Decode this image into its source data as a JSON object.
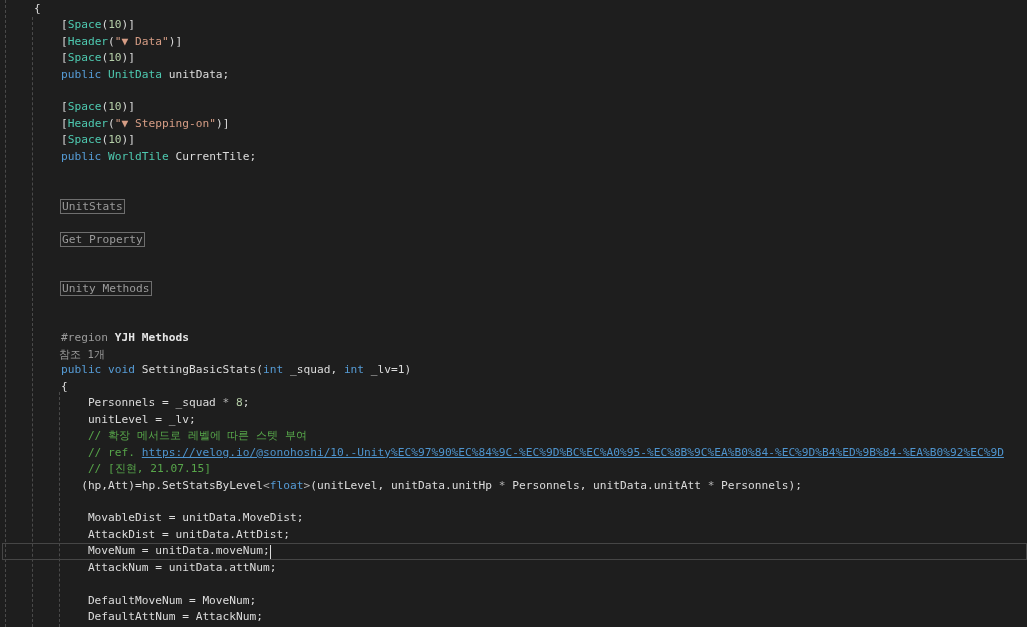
{
  "editor": {
    "lines": [
      {
        "current": false,
        "segments": [
          {
            "text": "{",
            "kind": "plain"
          }
        ]
      },
      {
        "current": false,
        "segments": [
          {
            "text": "    [",
            "kind": "plain"
          },
          {
            "text": "Space",
            "kind": "type"
          },
          {
            "text": "(",
            "kind": "plain"
          },
          {
            "text": "10",
            "kind": "number"
          },
          {
            "text": ")]",
            "kind": "plain"
          }
        ]
      },
      {
        "current": false,
        "segments": [
          {
            "text": "    [",
            "kind": "plain"
          },
          {
            "text": "Header",
            "kind": "type"
          },
          {
            "text": "(",
            "kind": "plain"
          },
          {
            "text": "\"▼ Data\"",
            "kind": "string"
          },
          {
            "text": ")]",
            "kind": "plain"
          }
        ]
      },
      {
        "current": false,
        "segments": [
          {
            "text": "    [",
            "kind": "plain"
          },
          {
            "text": "Space",
            "kind": "type"
          },
          {
            "text": "(",
            "kind": "plain"
          },
          {
            "text": "10",
            "kind": "number"
          },
          {
            "text": ")]",
            "kind": "plain"
          }
        ]
      },
      {
        "current": false,
        "segments": [
          {
            "text": "    public ",
            "kind": "keyword"
          },
          {
            "text": "UnitData",
            "kind": "type"
          },
          {
            "text": " unitData;",
            "kind": "plain"
          }
        ]
      },
      {
        "current": false
      },
      {
        "current": false,
        "segments": [
          {
            "text": "    [",
            "kind": "plain"
          },
          {
            "text": "Space",
            "kind": "type"
          },
          {
            "text": "(",
            "kind": "plain"
          },
          {
            "text": "10",
            "kind": "number"
          },
          {
            "text": ")]",
            "kind": "plain"
          }
        ]
      },
      {
        "current": false,
        "segments": [
          {
            "text": "    [",
            "kind": "plain"
          },
          {
            "text": "Header",
            "kind": "type"
          },
          {
            "text": "(",
            "kind": "plain"
          },
          {
            "text": "\"▼ Stepping-on\"",
            "kind": "string"
          },
          {
            "text": ")]",
            "kind": "plain"
          }
        ]
      },
      {
        "current": false,
        "segments": [
          {
            "text": "    [",
            "kind": "plain"
          },
          {
            "text": "Space",
            "kind": "type"
          },
          {
            "text": "(",
            "kind": "plain"
          },
          {
            "text": "10",
            "kind": "number"
          },
          {
            "text": ")]",
            "kind": "plain"
          }
        ]
      },
      {
        "current": false,
        "segments": [
          {
            "text": "    public ",
            "kind": "keyword"
          },
          {
            "text": "WorldTile",
            "kind": "type"
          },
          {
            "text": " CurrentTile;",
            "kind": "plain"
          }
        ]
      },
      {
        "current": false
      },
      {
        "current": false
      },
      {
        "current": false,
        "segments": [
          {
            "text": "UnitStats",
            "kind": "folded"
          }
        ]
      },
      {
        "current": false
      },
      {
        "current": false,
        "segments": [
          {
            "text": "Get Property",
            "kind": "folded"
          }
        ]
      },
      {
        "current": false
      },
      {
        "current": false
      },
      {
        "current": false,
        "segments": [
          {
            "text": "Unity Methods",
            "kind": "folded"
          }
        ]
      },
      {
        "current": false
      },
      {
        "current": false
      },
      {
        "current": false,
        "segments": [
          {
            "text": "    #region ",
            "kind": "directive"
          },
          {
            "text": "YJH Methods",
            "kind": "region_name"
          }
        ]
      },
      {
        "current": false,
        "segments": [
          {
            "text": "    참조 1개",
            "kind": "codelens"
          }
        ]
      },
      {
        "current": false,
        "segments": [
          {
            "text": "    public void ",
            "kind": "keyword"
          },
          {
            "text": "SettingBasicStats(",
            "kind": "plain"
          },
          {
            "text": "int",
            "kind": "keyword"
          },
          {
            "text": " _squad, ",
            "kind": "plain"
          },
          {
            "text": "int",
            "kind": "keyword"
          },
          {
            "text": " _lv=1)",
            "kind": "plain"
          }
        ]
      },
      {
        "current": false,
        "segments": [
          {
            "text": "    {",
            "kind": "plain"
          }
        ]
      },
      {
        "current": false,
        "segments": [
          {
            "text": "        Personnels = _squad ",
            "kind": "plain"
          },
          {
            "text": "* ",
            "kind": "operator"
          },
          {
            "text": "8",
            "kind": "number"
          },
          {
            "text": ";",
            "kind": "plain"
          }
        ]
      },
      {
        "current": false,
        "segments": [
          {
            "text": "        unitLevel = _lv;",
            "kind": "plain"
          }
        ]
      },
      {
        "current": false,
        "segments": [
          {
            "text": "        // 확장 메서드로 레벨에 따른 스텟 부여",
            "kind": "comment"
          }
        ]
      },
      {
        "current": false,
        "segments": [
          {
            "text": "        // ref. ",
            "kind": "comment"
          },
          {
            "text": "https://velog.io/@sonohoshi/10.-Unity%EC%97%90%EC%84%9C-%EC%9D%BC%EC%A0%95-%EC%8B%9C%EA%B0%84-%EC%9D%B4%ED%9B%84-%EA%B0%92%EC%9D",
            "kind": "link"
          }
        ]
      },
      {
        "current": false,
        "segments": [
          {
            "text": "        // [진현, 21.07.15]",
            "kind": "comment"
          }
        ]
      },
      {
        "current": false,
        "segments": [
          {
            "text": "       (hp,Att)=hp.SetStatsByLevel",
            "kind": "plain"
          },
          {
            "text": "<",
            "kind": "operator"
          },
          {
            "text": "float",
            "kind": "keyword"
          },
          {
            "text": ">",
            "kind": "operator"
          },
          {
            "text": "(unitLevel, unitData.unitHp ",
            "kind": "plain"
          },
          {
            "text": "*",
            "kind": "operator"
          },
          {
            "text": " Personnels, unitData.unitAtt ",
            "kind": "plain"
          },
          {
            "text": "*",
            "kind": "operator"
          },
          {
            "text": " Personnels);",
            "kind": "plain"
          }
        ]
      },
      {
        "current": false
      },
      {
        "current": false,
        "segments": [
          {
            "text": "        MovableDist = unitData.MoveDist;",
            "kind": "plain"
          }
        ]
      },
      {
        "current": false,
        "segments": [
          {
            "text": "        AttackDist = unitData.AttDist;",
            "kind": "plain"
          }
        ]
      },
      {
        "current": true,
        "segments": [
          {
            "text": "        MoveNum = unitData.moveNum;",
            "kind": "plain"
          }
        ]
      },
      {
        "current": false,
        "segments": [
          {
            "text": "        AttackNum = unitData.attNum;",
            "kind": "plain"
          }
        ]
      },
      {
        "current": false
      },
      {
        "current": false,
        "segments": [
          {
            "text": "        DefaultMoveNum = MoveNum;",
            "kind": "plain"
          }
        ]
      },
      {
        "current": false,
        "segments": [
          {
            "text": "        DefaultAttNum = AttackNum;",
            "kind": "plain"
          }
        ]
      }
    ]
  }
}
